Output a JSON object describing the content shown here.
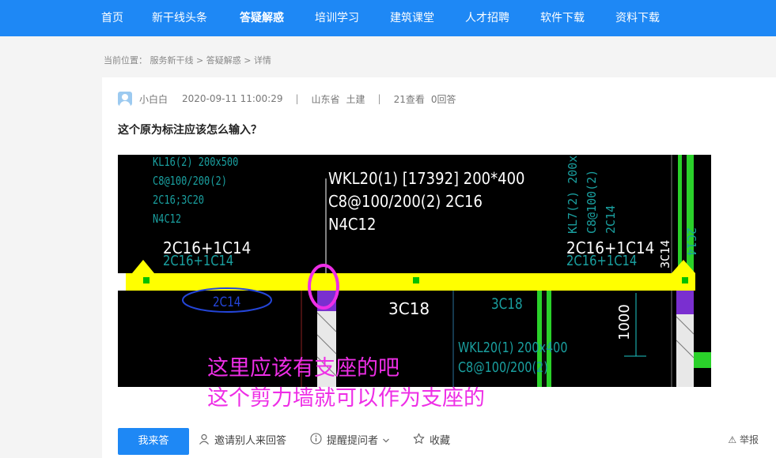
{
  "nav": {
    "items": [
      "首页",
      "新干线头条",
      "答疑解惑",
      "培训学习",
      "建筑课堂",
      "人才招聘",
      "软件下载",
      "资料下载"
    ],
    "active": "答疑解惑"
  },
  "breadcrumb": {
    "label": "当前位置：",
    "items": [
      "服务新干线",
      "答疑解惑",
      "详情"
    ],
    "sep": ">"
  },
  "question": {
    "author": "小白白",
    "datetime": "2020-09-11 11:00:29",
    "province": "山东省",
    "category": "土建",
    "views": "21查看",
    "answers": "0回答",
    "title": "这个原为标注应该怎么输入？"
  },
  "image": {
    "beam_label_1": "WKL20(1) [17392] 200*400",
    "beam_label_2": "C8@100/200(2) 2C16",
    "beam_label_3": "N4C12",
    "top_left_1": "KL16(2) 200x500",
    "top_left_2": "C8@100/200(2)",
    "top_left_3": "2C16;3C20",
    "top_left_4": "N4C12",
    "left_rebar": "2C16+1C14",
    "left_rebar_cyan": "2C16+1C14",
    "right_rebar": "2C16+1C14",
    "right_rebar_cyan": "2C16+1C14",
    "bottom_mid": "3C18",
    "bottom_mid_cyan": "3C18",
    "circled_left": "2C14",
    "right_vertical_1": "KL7(2) 200x",
    "right_vertical_2": "C8@100(2)",
    "right_vertical_3": "2C14",
    "right_edge_cyan": "2C14",
    "right_edge_2": "3C14",
    "dim": "1000",
    "bottom_cyan_1": "WKL20(1) 200x400",
    "bottom_cyan_2": "C8@100/200(2)",
    "annotation_1": "这里应该有支座的吧",
    "annotation_2": "这个剪力墙就可以作为支座的"
  },
  "actions": {
    "answer": "我来答",
    "invite": "邀请别人来回答",
    "remind": "提醒提问者",
    "favorite": "收藏",
    "report": "举报"
  },
  "colors": {
    "nav_bg": "#1e88f5",
    "beam_yellow": "#ffff00",
    "annotation": "#ee2ee6"
  }
}
